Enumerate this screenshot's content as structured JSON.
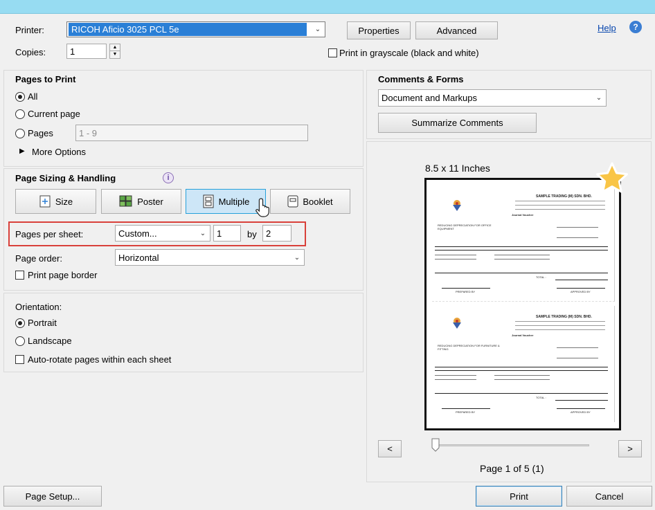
{
  "printer": {
    "label": "Printer:",
    "selected": "RICOH Aficio 3025 PCL 5e",
    "properties_label": "Properties",
    "advanced_label": "Advanced",
    "help_label": "Help"
  },
  "copies": {
    "label": "Copies:",
    "value": "1",
    "grayscale_label": "Print in grayscale (black and white)"
  },
  "pages_to_print": {
    "header": "Pages to Print",
    "all_label": "All",
    "current_label": "Current page",
    "pages_label": "Pages",
    "pages_value": "1 - 9",
    "more_options_label": "More Options"
  },
  "sizing": {
    "header": "Page Sizing & Handling",
    "size_label": "Size",
    "poster_label": "Poster",
    "multiple_label": "Multiple",
    "booklet_label": "Booklet",
    "pages_per_sheet_label": "Pages per sheet:",
    "pages_per_sheet_value": "Custom...",
    "cols_value": "1",
    "by_label": "by",
    "rows_value": "2",
    "page_order_label": "Page order:",
    "page_order_value": "Horizontal",
    "border_label": "Print page border"
  },
  "orientation": {
    "header": "Orientation:",
    "portrait_label": "Portrait",
    "landscape_label": "Landscape",
    "autorotate_label": "Auto-rotate pages within each sheet"
  },
  "comments": {
    "header": "Comments & Forms",
    "selected": "Document and Markups",
    "summarize_label": "Summarize Comments"
  },
  "preview": {
    "paper_size": "8.5 x 11 Inches",
    "prev_label": "<",
    "next_label": ">",
    "page_indicator": "Page 1 of 5 (1)",
    "doc": {
      "company": "SAMPLE TRADING (M) SDN. BHD.",
      "title": "Journal Voucher",
      "memo1": "REDUCING DEPRECIATION FOR OFFICE EQUIPMENT",
      "memo2": "REDUCING DEPRECIATION FOR FURNITURE & FITTING",
      "total_label": "TOTAL :",
      "prepared_by": "PREPARED BY",
      "approved_by": "APPROVED BY"
    }
  },
  "footer": {
    "page_setup_label": "Page Setup...",
    "print_label": "Print",
    "cancel_label": "Cancel"
  },
  "colors": {
    "titlebar": "#97dcf2",
    "highlight": "#2a7fd6",
    "callout_border": "#d9403a",
    "link": "#0645ad"
  }
}
